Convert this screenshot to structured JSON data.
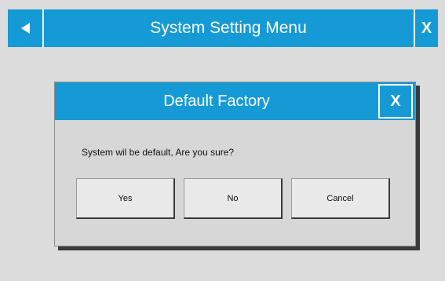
{
  "window": {
    "title": "System Setting Menu",
    "back_icon": "back-arrow-icon",
    "close_label": "X"
  },
  "dialog": {
    "title": "Default Factory",
    "close_label": "X",
    "message": "System wil be default, Are you sure?",
    "buttons": {
      "yes": "Yes",
      "no": "No",
      "cancel": "Cancel"
    }
  },
  "colors": {
    "accent": "#169ad6",
    "background": "#dcdcdc",
    "dialog_background": "#d7d7d7",
    "button_face": "#e9e9e9"
  }
}
